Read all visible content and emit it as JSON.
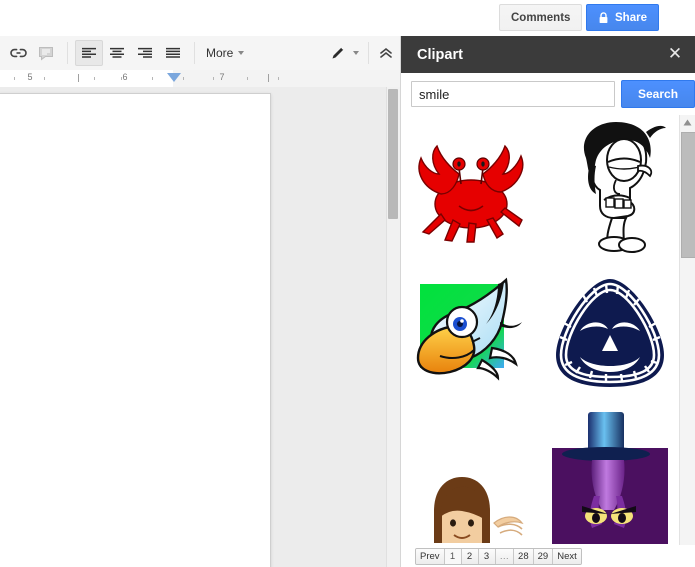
{
  "topbar": {
    "comments_label": "Comments",
    "share_label": "Share",
    "share_icon": "lock-icon",
    "share_color": "#4d90fe"
  },
  "toolbar": {
    "buttons": [
      {
        "name": "insert-link",
        "icon": "link-icon",
        "active": false
      },
      {
        "name": "add-comment",
        "icon": "comment-icon",
        "active": false
      },
      {
        "name": "align-left",
        "icon": "align-left-icon",
        "active": true
      },
      {
        "name": "align-center",
        "icon": "align-center-icon",
        "active": false
      },
      {
        "name": "align-right",
        "icon": "align-right-icon",
        "active": false
      },
      {
        "name": "align-justify",
        "icon": "align-justify-icon",
        "active": false
      }
    ],
    "more_label": "More",
    "pencil_icon": "pencil-icon",
    "collapse_icon": "double-chevron-up-icon"
  },
  "ruler": {
    "numbers": [
      "5",
      "6",
      "7"
    ],
    "indent_marker": "left-indent-marker"
  },
  "panel": {
    "title": "Clipart",
    "close_label": "✕",
    "search": {
      "value": "smile",
      "placeholder": "",
      "button_label": "Search"
    },
    "results": [
      {
        "name": "clipart-red-crab",
        "alt": "red crab"
      },
      {
        "name": "clipart-cartoon-face",
        "alt": "black and white cartoon face with hair"
      },
      {
        "name": "clipart-bird-head",
        "alt": "blue bird head on green square"
      },
      {
        "name": "clipart-navy-mask",
        "alt": "navy smiling mask"
      },
      {
        "name": "clipart-brown-hair-person",
        "alt": "person with brown hair"
      },
      {
        "name": "clipart-purple-tophat-character",
        "alt": "purple character with blue top hat"
      }
    ],
    "pagination": {
      "prev_label": "Prev",
      "next_label": "Next",
      "pages": [
        "1",
        "2",
        "3",
        "…",
        "28",
        "29"
      ],
      "current": "1"
    }
  }
}
